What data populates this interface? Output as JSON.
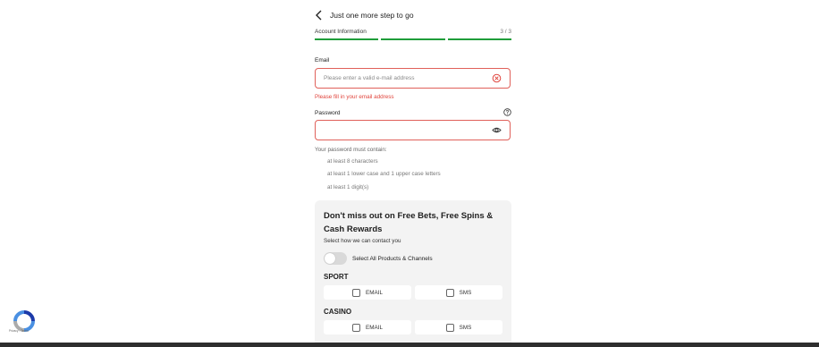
{
  "header": {
    "title": "Just one more step to go",
    "back_icon": "chevron-left-icon"
  },
  "progress": {
    "step_label": "Account Information",
    "step_count": "3 / 3",
    "segments": 3,
    "completed": 3,
    "color": "#1f9d3a"
  },
  "email": {
    "label": "Email",
    "placeholder": "Please enter a valid e-mail address",
    "value": "",
    "error_icon": "error-circle-icon",
    "error": "Please fill in your email address",
    "error_color": "#e0443c"
  },
  "password": {
    "label": "Password",
    "value": "",
    "help_icon": "help-circle-icon",
    "visibility_icon": "eye-icon",
    "rules_title": "Your password must contain:",
    "rules": [
      "at least 8 characters",
      "at least 1 lower case and 1 upper case letters",
      "at least 1 digit(s)"
    ]
  },
  "promo": {
    "title": "Don't miss out on Free Bets, Free Spins & Cash Rewards",
    "subtitle": "Select how we can contact you",
    "toggle_label": "Select All Products & Channels",
    "toggle_on": false,
    "groups": [
      {
        "title": "SPORT",
        "options": [
          "EMAIL",
          "SMS"
        ]
      },
      {
        "title": "CASINO",
        "options": [
          "EMAIL",
          "SMS"
        ]
      }
    ]
  },
  "recaptcha": {
    "icon": "recaptcha-icon",
    "text": "Privacy - Terms"
  }
}
